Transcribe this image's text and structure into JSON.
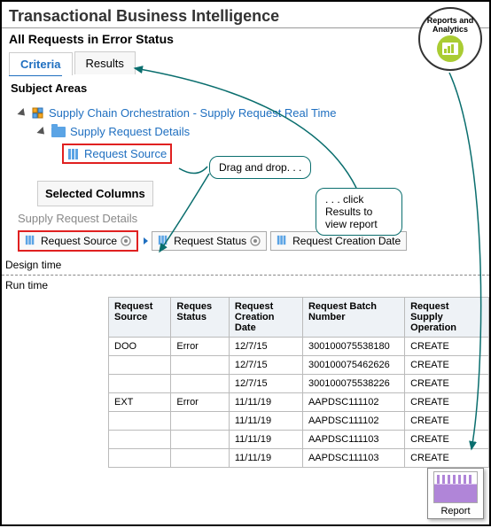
{
  "header": {
    "title": "Transactional Business Intelligence",
    "subtitle": "All Requests in Error Status"
  },
  "tabs": {
    "criteria": "Criteria",
    "results": "Results"
  },
  "subject_areas": {
    "heading": "Subject Areas",
    "root": "Supply Chain Orchestration - Supply Request Real Time",
    "folder": "Supply Request Details",
    "leaf": "Request Source"
  },
  "selected_columns": {
    "heading": "Selected Columns",
    "group_label": "Supply Request Details",
    "cols": [
      "Request Source",
      "Request Status",
      "Request Creation Date"
    ]
  },
  "callouts": {
    "drag": "Drag and drop. . .",
    "results": ". . . click Results to view  report"
  },
  "phases": {
    "design": "Design time",
    "run": "Run time"
  },
  "badge": {
    "line1": "Reports and",
    "line2": "Analytics"
  },
  "report_card": {
    "label": "Report"
  },
  "chart_data": {
    "type": "table",
    "columns": [
      "Request Source",
      "Reques Status",
      "Request Creation Date",
      "Request Batch Number",
      "Request Supply Operation"
    ],
    "rows": [
      [
        "DOO",
        "Error",
        "12/7/15",
        "300100075538180",
        "CREATE"
      ],
      [
        "",
        "",
        "12/7/15",
        "300100075462626",
        "CREATE"
      ],
      [
        "",
        "",
        "12/7/15",
        "300100075538226",
        "CREATE"
      ],
      [
        "EXT",
        "Error",
        "11/11/19",
        "AAPDSC111102",
        "CREATE"
      ],
      [
        "",
        "",
        "11/11/19",
        "AAPDSC111102",
        "CREATE"
      ],
      [
        "",
        "",
        "11/11/19",
        "AAPDSC111103",
        "CREATE"
      ],
      [
        "",
        "",
        "11/11/19",
        "AAPDSC111103",
        "CREATE"
      ]
    ]
  }
}
